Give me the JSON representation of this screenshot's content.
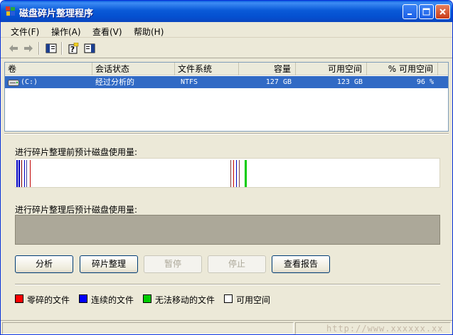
{
  "window": {
    "title": "磁盘碎片整理程序"
  },
  "menu": {
    "items": [
      {
        "label": "文件(F)"
      },
      {
        "label": "操作(A)"
      },
      {
        "label": "查看(V)"
      },
      {
        "label": "帮助(H)"
      }
    ]
  },
  "toolbar": {
    "icons": [
      "back-arrow-icon",
      "forward-arrow-icon",
      "show-hide-console-tree-icon",
      "help-icon",
      "properties-icon"
    ]
  },
  "volume_list": {
    "columns": [
      "卷",
      "会话状态",
      "文件系统",
      "容量",
      "可用空间",
      "% 可用空间"
    ],
    "rows": [
      {
        "volume": "(C:)",
        "status": "经过分析的",
        "fs": "NTFS",
        "capacity": "127 GB",
        "free": "123 GB",
        "pct_free": "96 %"
      }
    ]
  },
  "analysis": {
    "before_label": "进行碎片整理前预计磁盘使用量:",
    "after_label": "进行碎片整理后预计磁盘使用量:"
  },
  "buttons": {
    "analyze": "分析",
    "defragment": "碎片整理",
    "pause": "暂停",
    "stop": "停止",
    "view_report": "查看报告"
  },
  "legend": {
    "fragmented": "零碎的文件",
    "contiguous": "连续的文件",
    "unmovable": "无法移动的文件",
    "free_space": "可用空间"
  },
  "colors": {
    "fragmented": "#ff0000",
    "contiguous": "#0000ff",
    "unmovable": "#00cc00",
    "free_space": "#ffffff",
    "selection": "#316ac5",
    "title_bar": "#0a5ad8"
  },
  "watermark": "http://www.xxxxxx.xx"
}
